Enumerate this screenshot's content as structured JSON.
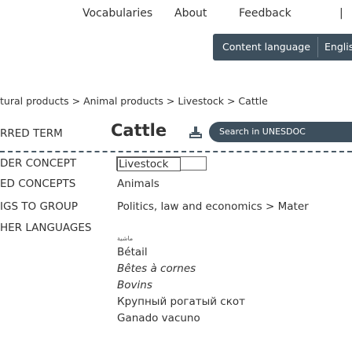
{
  "nav": {
    "vocabularies": "Vocabularies",
    "about": "About",
    "feedback": "Feedback",
    "separator": "|"
  },
  "language_bar": {
    "label": "Content language",
    "selected": "English",
    "caret": "▾"
  },
  "breadcrumb": "tural products > Animal products > Livestock > Cattle",
  "term": {
    "pref_label": "RRED TERM",
    "title": "Cattle",
    "search_label": "Search in UNESDOC"
  },
  "rows": {
    "broader_label": "DER CONCEPT",
    "broader_value": "Livestock",
    "related_label": "ED CONCEPTS",
    "related_value": "Animals",
    "group_label": "IGS TO GROUP",
    "group_value": "Politics, law and economics > Mater",
    "other_lang_label": "HER LANGUAGES"
  },
  "other_languages": [
    {
      "text": "ماشية",
      "style": "arabic"
    },
    {
      "text": "Bétail",
      "style": ""
    },
    {
      "text": "Bêtes à cornes",
      "style": "italic"
    },
    {
      "text": "Bovins",
      "style": "italic"
    },
    {
      "text": "Крупный рогатый скот",
      "style": ""
    },
    {
      "text": "Ganado vacuno",
      "style": ""
    }
  ],
  "colors": {
    "nav_bg": "#3d4f5d",
    "text": "#333333"
  }
}
